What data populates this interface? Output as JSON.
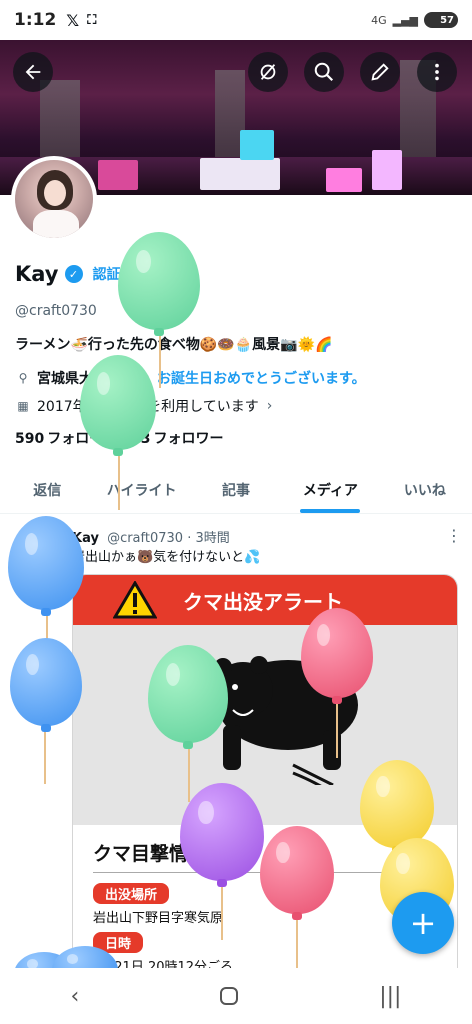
{
  "status": {
    "time": "1:12",
    "network": "4G",
    "battery": "57"
  },
  "profile": {
    "name": "Kay",
    "get_verified": "認証を受ける",
    "handle": "@craft0730",
    "bio": "ラーメン🍜行った先の食べ物🍪🍩🧁風景📷🌞🌈",
    "location": "宮城県大崎市",
    "birthday": "お誕生日おめでとうございます。",
    "joined": "2017年1月からXを利用しています",
    "following_count": "590",
    "following_label": "フォロー",
    "followers_count": "493",
    "followers_label": "フォロワー"
  },
  "tabs": [
    {
      "label": "返信"
    },
    {
      "label": "ハイライト"
    },
    {
      "label": "記事"
    },
    {
      "label": "メディア"
    },
    {
      "label": "いいね"
    }
  ],
  "post": {
    "author": "Kay",
    "handle": "@craft0730",
    "time": "· 3時間",
    "text": "岩出山かぁ🐻気を付けないと💦",
    "image": {
      "header": "クマ出没アラート",
      "sighting_title": "クマ目撃情報",
      "place_label": "出没場所",
      "place_value": "岩出山下野目字寒気原",
      "datetime_label": "日時",
      "datetime_value": "4月21日 20時12分ごろ"
    }
  },
  "icons": {
    "back": "arrow-left-icon",
    "grok": "slash-circle-icon",
    "search": "search-icon",
    "edit": "pencil-icon",
    "more": "more-vertical-icon",
    "compose": "plus-icon"
  },
  "colors": {
    "accent": "#1d9bf0",
    "alert_red": "#e53a2a"
  }
}
